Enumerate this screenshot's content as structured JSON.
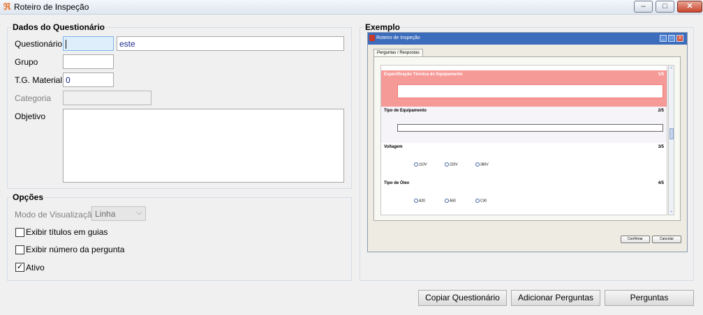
{
  "window": {
    "title": "Roteiro de Inspeção",
    "minimize": "‒",
    "maximize": "□",
    "close": "✕"
  },
  "dados": {
    "title": "Dados do Questionário",
    "questionario_label": "Questionário",
    "questionario_code": "",
    "questionario_name": "este",
    "grupo_label": "Grupo",
    "grupo_value": "",
    "tg_label": "T.G. Material",
    "tg_value": "0",
    "categoria_label": "Categoria",
    "categoria_value": "",
    "objetivo_label": "Objetivo",
    "objetivo_value": ""
  },
  "opcoes": {
    "title": "Opções",
    "modo_label": "Modo de Visualização",
    "modo_value": "Linha",
    "exibir_titulos": {
      "label": "Exibir títulos em guias",
      "checked": false
    },
    "exibir_numero": {
      "label": "Exibir número da pergunta",
      "checked": false
    },
    "ativo": {
      "label": "Ativo",
      "checked": true
    }
  },
  "exemplo": {
    "title": "Exemplo",
    "window_title": "Roteiro de Inspeção",
    "tab": "Perguntas / Respostas",
    "questions": [
      {
        "title": "Especificação Técnica do Equipamento",
        "number": "1/5",
        "kind": "text",
        "highlight": "#f69a98"
      },
      {
        "title": "Tipo de Equipamento",
        "number": "2/5",
        "kind": "text",
        "highlight": "#f6f4f9"
      },
      {
        "title": "Voltagem",
        "number": "3/5",
        "kind": "radio",
        "options": [
          "110V",
          "220V",
          "380V"
        ]
      },
      {
        "title": "Tipo de Óleo",
        "number": "4/5",
        "kind": "radio",
        "options": [
          "A20",
          "A50",
          "C30"
        ]
      }
    ],
    "confirm": "Confirmar",
    "cancel": "Cancelar"
  },
  "buttons": {
    "copiar": "Copiar Questionário",
    "adicionar": "Adicionar Perguntas",
    "perguntas": "Perguntas"
  }
}
